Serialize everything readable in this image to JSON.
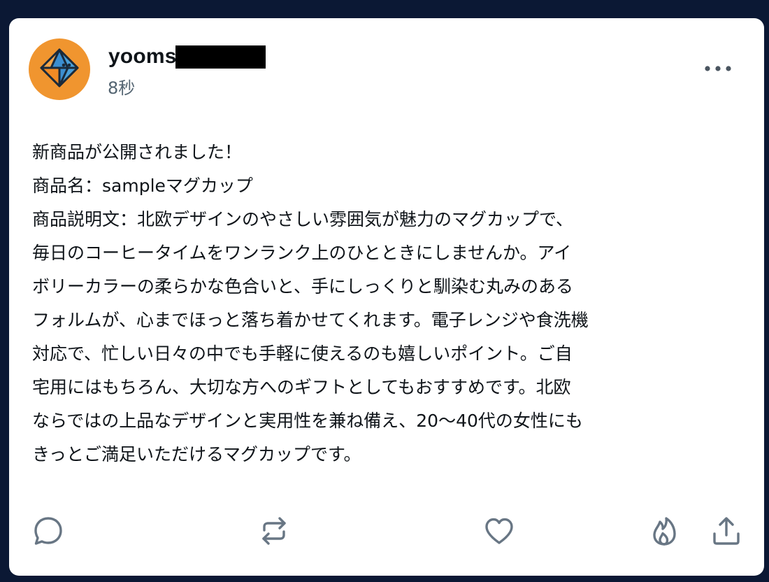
{
  "post": {
    "username": "yooms",
    "timestamp": "8秒",
    "lines": [
      "新商品が公開されました！",
      "商品名：sampleマグカップ",
      "商品説明文：北欧デザインのやさしい雰囲気が魅力のマグカップで、",
      "毎日のコーヒータイムをワンランク上のひとときにしませんか。アイ",
      "ボリーカラーの柔らかな色合いと、手にしっくりと馴染む丸みのある",
      "フォルムが、心までほっと落ち着かせてくれます。電子レンジや食洗機",
      "対応で、忙しい日々の中でも手軽に使えるのも嬉しいポイント。ご自",
      "宅用にはもちろん、大切な方へのギフトとしてもおすすめです。北欧",
      "ならではの上品なデザインと実用性を兼ね備え、20〜40代の女性にも",
      "きっとご満足いただけるマグカップです。"
    ]
  },
  "icons": {
    "avatar": "diamond-logo-icon",
    "more": "more-horizontal-icon",
    "reply": "comment-icon",
    "repost": "repost-icon",
    "like": "heart-icon",
    "boost": "flame-icon",
    "share": "share-icon"
  },
  "colors": {
    "background": "#0b1834",
    "card": "#ffffff",
    "avatar": "#f0952f",
    "text": "#0f1419",
    "muted": "#536471",
    "icon": "#687684"
  }
}
